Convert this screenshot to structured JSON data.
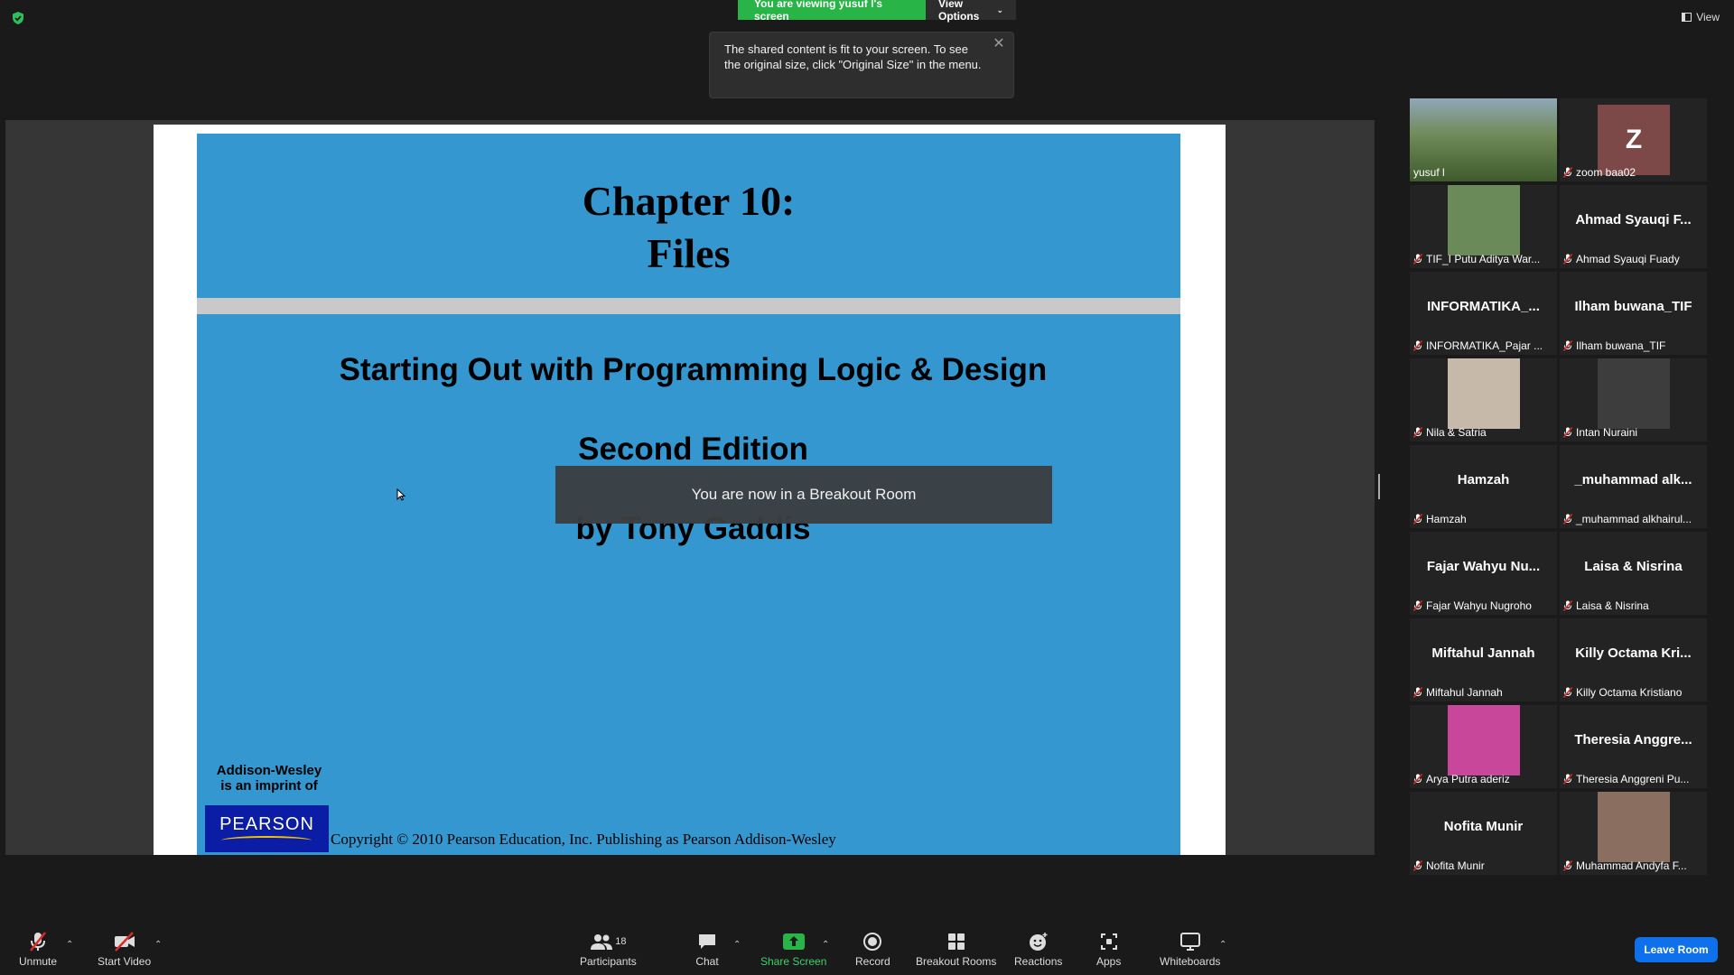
{
  "share_banner": {
    "viewing": "You are viewing yusuf l's screen",
    "view_options": "View Options"
  },
  "tooltip": {
    "text": "The shared content is fit to your screen. To see the original size, click \"Original Size\" in the menu."
  },
  "view_toggle": {
    "label": "View"
  },
  "slide": {
    "title_line1": "Chapter 10:",
    "title_line2": "Files",
    "subtitle1": "Starting Out with Programming Logic & Design",
    "subtitle2": "Second Edition",
    "subtitle3": "by Tony Gaddis",
    "publisher_line1": "Addison-Wesley",
    "publisher_line2": "is an imprint of",
    "logo": "PEARSON",
    "copyright": "Copyright © 2010 Pearson Education, Inc. Publishing as Pearson Addison-Wesley"
  },
  "breakout_toast": "You are now in a Breakout Room",
  "gallery": [
    {
      "label": "yusuf l",
      "display": "",
      "kind": "video",
      "active": true
    },
    {
      "label": "zoom baa02",
      "display": "Z",
      "kind": "letter"
    },
    {
      "label": "TIF_I Putu Aditya War...",
      "display": "",
      "kind": "photo"
    },
    {
      "label": "Ahmad Syauqi Fuady",
      "display": "Ahmad Syauqi F..."
    },
    {
      "label": "INFORMATIKA_Pajar ...",
      "display": "INFORMATIKA_..."
    },
    {
      "label": "Ilham buwana_TIF",
      "display": "Ilham buwana_TIF"
    },
    {
      "label": "Nila & Satria",
      "display": "",
      "kind": "photo"
    },
    {
      "label": "Intan Nuraini",
      "display": "",
      "kind": "photo"
    },
    {
      "label": "Hamzah",
      "display": "Hamzah"
    },
    {
      "label": "_muhammad alkhairul...",
      "display": "_muhammad  alk..."
    },
    {
      "label": "Fajar Wahyu Nugroho",
      "display": "Fajar Wahyu Nu..."
    },
    {
      "label": "Laisa & Nisrina",
      "display": "Laisa & Nisrina"
    },
    {
      "label": "Miftahul Jannah",
      "display": "Miftahul Jannah"
    },
    {
      "label": "Killy Octama Kristiano",
      "display": "Killy Octama Kri..."
    },
    {
      "label": "Arya Putra aderiz",
      "display": "",
      "kind": "photo"
    },
    {
      "label": "Theresia Anggreni Pu...",
      "display": "Theresia  Anggre..."
    },
    {
      "label": "Nofita Munir",
      "display": "Nofita Munir"
    },
    {
      "label": "Muhammad Andyfa F...",
      "display": "",
      "kind": "photo"
    }
  ],
  "toolbar": {
    "unmute": "Unmute",
    "start_video": "Start Video",
    "participants": "Participants",
    "participants_count": "18",
    "chat": "Chat",
    "share_screen": "Share Screen",
    "record": "Record",
    "breakout_rooms": "Breakout Rooms",
    "reactions": "Reactions",
    "apps": "Apps",
    "whiteboards": "Whiteboards",
    "leave_room": "Leave Room"
  },
  "colors": {
    "accent_green": "#28b446",
    "slide_blue": "#3597cf",
    "leave_blue": "#0e71eb",
    "active_speaker": "#c8e34d"
  }
}
